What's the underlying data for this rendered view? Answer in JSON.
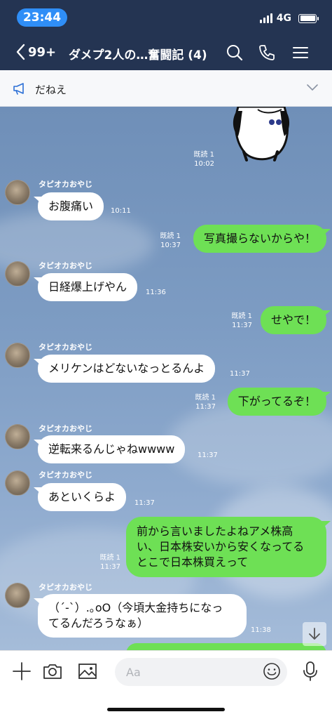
{
  "status": {
    "time": "23:44",
    "network": "4G"
  },
  "nav": {
    "unread_count": "99+",
    "title": "ダメプ2人の…奮闘記 (4)"
  },
  "announcement": {
    "text": "だねえ"
  },
  "messages": [
    {
      "read": "既読 1",
      "time": "10:02"
    },
    {
      "sender": "タピオカおやじ",
      "text": "お腹痛い",
      "time": "10:11"
    },
    {
      "read": "既読 1",
      "time": "10:37",
      "text": "写真撮らないからや！"
    },
    {
      "sender": "タピオカおやじ",
      "text": "日経爆上げやん",
      "time": "11:36"
    },
    {
      "read": "既読 1",
      "time": "11:37",
      "text": "せやで！"
    },
    {
      "sender": "タピオカおやじ",
      "text": "メリケンはどないなっとるんよ",
      "time": "11:37"
    },
    {
      "read": "既読 1",
      "time": "11:37",
      "text": "下がってるぞ！"
    },
    {
      "sender": "タピオカおやじ",
      "text": "逆転来るんじゃねwwww",
      "time": "11:37"
    },
    {
      "sender": "タピオカおやじ",
      "text": "あといくらよ",
      "time": "11:37"
    },
    {
      "read": "既読 1",
      "time": "11:37",
      "lines": [
        "前から言いましたよねアメ株高",
        "い、日本株安いから安くなってる",
        "とこで日本株買えって"
      ]
    },
    {
      "sender": "タピオカおやじ",
      "lines": [
        "（´-`）.｡oO（今頃大金持ちになっ",
        "てるんだろうなぁ）"
      ],
      "time": "11:38"
    }
  ],
  "composer": {
    "placeholder": "Aa"
  }
}
